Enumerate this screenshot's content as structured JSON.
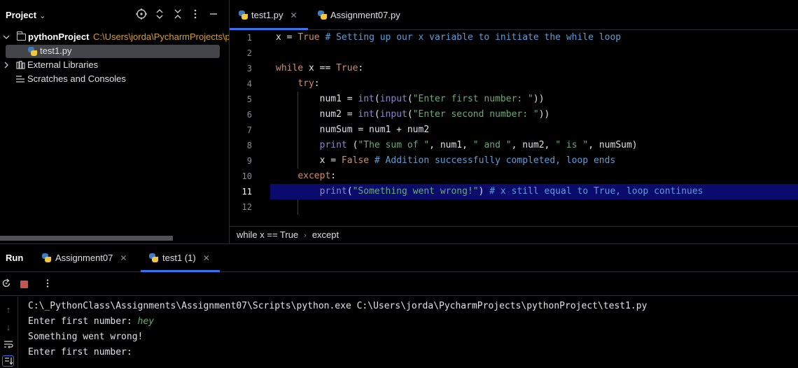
{
  "project_panel": {
    "title": "Project",
    "chevron": "⌄",
    "header_icons": [
      "target-icon",
      "expand-collapse-icon",
      "close-all-icon",
      "more-icon",
      "minimize-icon"
    ],
    "tree": {
      "root": {
        "label": "pythonProject",
        "path": "C:\\Users\\jorda\\PycharmProjects\\pythonProject"
      },
      "file": {
        "label": "test1.py"
      },
      "external_libraries": {
        "label": "External Libraries"
      },
      "scratches": {
        "label": "Scratches and Consoles"
      }
    }
  },
  "editor": {
    "tabs": [
      {
        "label": "test1.py",
        "active": true
      },
      {
        "label": "Assignment07.py",
        "active": false
      }
    ],
    "line_numbers": [
      "1",
      "2",
      "3",
      "4",
      "5",
      "6",
      "7",
      "8",
      "9",
      "10",
      "11",
      "12"
    ],
    "current_line": 11,
    "breadcrumb": [
      "while x == True",
      "except"
    ]
  },
  "run_panel": {
    "title": "Run",
    "tabs": [
      {
        "label": "Assignment07",
        "active": false
      },
      {
        "label": "test1 (1)",
        "active": true
      }
    ],
    "console": {
      "command": "C:\\_PythonClass\\Assignments\\Assignment07\\Scripts\\python.exe C:\\Users\\jorda\\PycharmProjects\\pythonProject\\test1.py",
      "prompt1": "Enter first number: ",
      "input1": "hey",
      "error": "Something went wrong!",
      "prompt2": "Enter first number: "
    }
  },
  "colors": {
    "accent": "#3574f0",
    "keyword": "#cf8e6d",
    "string": "#6aab73",
    "comment": "#5d9ed6",
    "highlight_line": "#0b0b6e",
    "path": "#d5a02a",
    "stop": "#c75450"
  }
}
